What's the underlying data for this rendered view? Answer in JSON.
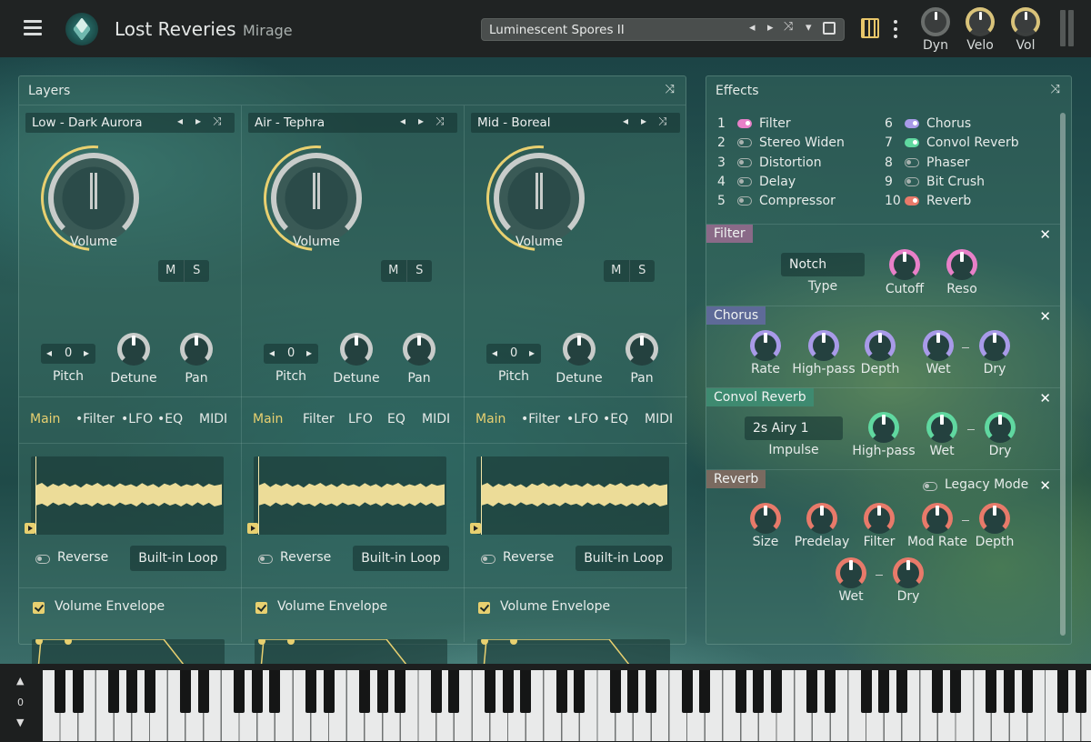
{
  "app": {
    "title": "Lost Reveries",
    "subtitle": "Mirage"
  },
  "preset": {
    "name": "Luminescent Spores II"
  },
  "header_knobs": [
    {
      "label": "Dyn"
    },
    {
      "label": "Velo"
    },
    {
      "label": "Vol"
    }
  ],
  "layers_panel": {
    "title": "Layers"
  },
  "layers": [
    {
      "name": "Low - Dark Aurora",
      "volume_label": "Volume",
      "mute": "M",
      "solo": "S",
      "pitch_value": "0",
      "pitch_label": "Pitch",
      "detune_label": "Detune",
      "pan_label": "Pan",
      "tabs": [
        "Main",
        "•Filter",
        "•LFO",
        "•EQ",
        "MIDI"
      ],
      "reverse_label": "Reverse",
      "loop_label": "Built-in Loop",
      "envelope_label": "Volume Envelope"
    },
    {
      "name": "Air - Tephra",
      "volume_label": "Volume",
      "mute": "M",
      "solo": "S",
      "pitch_value": "0",
      "pitch_label": "Pitch",
      "detune_label": "Detune",
      "pan_label": "Pan",
      "tabs": [
        "Main",
        "Filter",
        "LFO",
        "EQ",
        "MIDI"
      ],
      "reverse_label": "Reverse",
      "loop_label": "Built-in Loop",
      "envelope_label": "Volume Envelope"
    },
    {
      "name": "Mid - Boreal",
      "volume_label": "Volume",
      "mute": "M",
      "solo": "S",
      "pitch_value": "0",
      "pitch_label": "Pitch",
      "detune_label": "Detune",
      "pan_label": "Pan",
      "tabs": [
        "Main",
        "•Filter",
        "•LFO",
        "•EQ",
        "MIDI"
      ],
      "reverse_label": "Reverse",
      "loop_label": "Built-in Loop",
      "envelope_label": "Volume Envelope"
    }
  ],
  "effects_panel": {
    "title": "Effects"
  },
  "effects_list": [
    {
      "num": "1",
      "name": "Filter",
      "color": "#e880c8",
      "on": true
    },
    {
      "num": "2",
      "name": "Stereo Widen",
      "color": "#a8b2af",
      "on": false
    },
    {
      "num": "3",
      "name": "Distortion",
      "color": "#a8b2af",
      "on": false
    },
    {
      "num": "4",
      "name": "Delay",
      "color": "#a8b2af",
      "on": false
    },
    {
      "num": "5",
      "name": "Compressor",
      "color": "#a8b2af",
      "on": false
    },
    {
      "num": "6",
      "name": "Chorus",
      "color": "#a89ae8",
      "on": true
    },
    {
      "num": "7",
      "name": "Convol Reverb",
      "color": "#60d8a0",
      "on": true
    },
    {
      "num": "8",
      "name": "Phaser",
      "color": "#a8b2af",
      "on": false
    },
    {
      "num": "9",
      "name": "Bit Crush",
      "color": "#a8b2af",
      "on": false
    },
    {
      "num": "10",
      "name": "Reverb",
      "color": "#e87a6a",
      "on": true
    }
  ],
  "filter": {
    "title": "Filter",
    "type_value": "Notch",
    "type_label": "Type",
    "cutoff_label": "Cutoff",
    "reso_label": "Reso",
    "color": "#e880c8",
    "header_bg": "#8a6a88"
  },
  "chorus": {
    "title": "Chorus",
    "labels": [
      "Rate",
      "High-pass",
      "Depth",
      "Wet",
      "Dry"
    ],
    "color": "#a89ae8",
    "header_bg": "#5e6a98"
  },
  "convol": {
    "title": "Convol Reverb",
    "impulse_value": "2s Airy 1",
    "impulse_label": "Impulse",
    "labels": [
      "High-pass",
      "Wet",
      "Dry"
    ],
    "color": "#60d8a0",
    "header_bg": "#3e8a70"
  },
  "reverb": {
    "title": "Reverb",
    "legacy_label": "Legacy Mode",
    "labels": [
      "Size",
      "Predelay",
      "Filter",
      "Mod Rate",
      "Depth",
      "Wet",
      "Dry"
    ],
    "color": "#e87a6a",
    "header_bg": "#7a6a60"
  },
  "keyboard": {
    "octave": "0"
  },
  "colors": {
    "accent": "#e8d070",
    "wave": "#ecdc98"
  }
}
